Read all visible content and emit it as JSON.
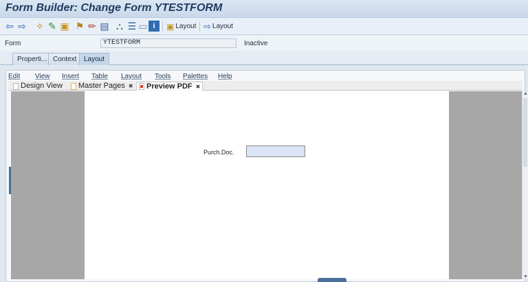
{
  "window": {
    "title": "Form Builder: Change Form YTESTFORM"
  },
  "toolbar": {
    "icons": [
      "back-arrow-icon",
      "forward-arrow-icon",
      "other-object-icon",
      "display-change-icon",
      "activate-icon",
      "check-icon",
      "test-icon",
      "where-used-icon",
      "hierarchy-icon",
      "pattern-icon",
      "table-icon",
      "info-icon"
    ],
    "layout1_label": "Layout",
    "layout2_label": "Layout"
  },
  "form": {
    "label": "Form",
    "value": "YTESTFORM",
    "status": "Inactive"
  },
  "tabs": [
    {
      "label": "Properti..."
    },
    {
      "label": "Context"
    },
    {
      "label": "Layout",
      "active": true
    }
  ],
  "menu": [
    "Edit",
    "View",
    "Insert",
    "Table",
    "Layout",
    "Tools",
    "Palettes",
    "Help"
  ],
  "doc_tabs": [
    {
      "label": "Design View"
    },
    {
      "label": "Master Pages"
    },
    {
      "label": "Preview PDF",
      "active": true
    }
  ],
  "canvas": {
    "field_label": "Purch.Doc."
  }
}
